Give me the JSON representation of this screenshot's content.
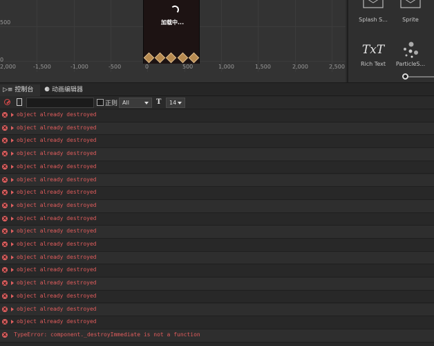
{
  "scene": {
    "x_ticks": [
      "2,000",
      "-1,500",
      "-1,000",
      "-500",
      "0",
      "500",
      "1,000",
      "1,500",
      "2,000",
      "2,500"
    ],
    "y_ticks": [
      "500",
      "0"
    ],
    "loading_text": "加载中..."
  },
  "assets": {
    "items": [
      {
        "label": "Splash S...",
        "icon": "splash-image-icon"
      },
      {
        "label": "Sprite",
        "icon": "sprite-icon"
      },
      {
        "label": "Rich Text",
        "icon": "rich-text-icon",
        "glyph": "TxT"
      },
      {
        "label": "ParticleS...",
        "icon": "particle-system-icon"
      }
    ]
  },
  "tabs": {
    "console": "控制台",
    "animation": "动画编辑器"
  },
  "toolbar": {
    "filter_value": "",
    "regex_label": "正则",
    "level_value": "All",
    "font_glyph": "T",
    "font_size_value": "14"
  },
  "logs": [
    {
      "type": "error",
      "text": "object already destroyed"
    },
    {
      "type": "error",
      "text": "object already destroyed"
    },
    {
      "type": "error",
      "text": "object already destroyed"
    },
    {
      "type": "error",
      "text": "object already destroyed"
    },
    {
      "type": "error",
      "text": "object already destroyed"
    },
    {
      "type": "error",
      "text": "object already destroyed"
    },
    {
      "type": "error",
      "text": "object already destroyed"
    },
    {
      "type": "error",
      "text": "object already destroyed"
    },
    {
      "type": "error",
      "text": "object already destroyed"
    },
    {
      "type": "error",
      "text": "object already destroyed"
    },
    {
      "type": "error",
      "text": "object already destroyed"
    },
    {
      "type": "error",
      "text": "object already destroyed"
    },
    {
      "type": "error",
      "text": "object already destroyed"
    },
    {
      "type": "error",
      "text": "object already destroyed"
    },
    {
      "type": "error",
      "text": "object already destroyed"
    },
    {
      "type": "error",
      "text": "object already destroyed"
    },
    {
      "type": "error",
      "text": "object already destroyed"
    },
    {
      "type": "error",
      "text": "TypeError: component._destroyImmediate is not a function"
    }
  ],
  "colors": {
    "error_text": "#e05c5c",
    "background": "#282828"
  }
}
